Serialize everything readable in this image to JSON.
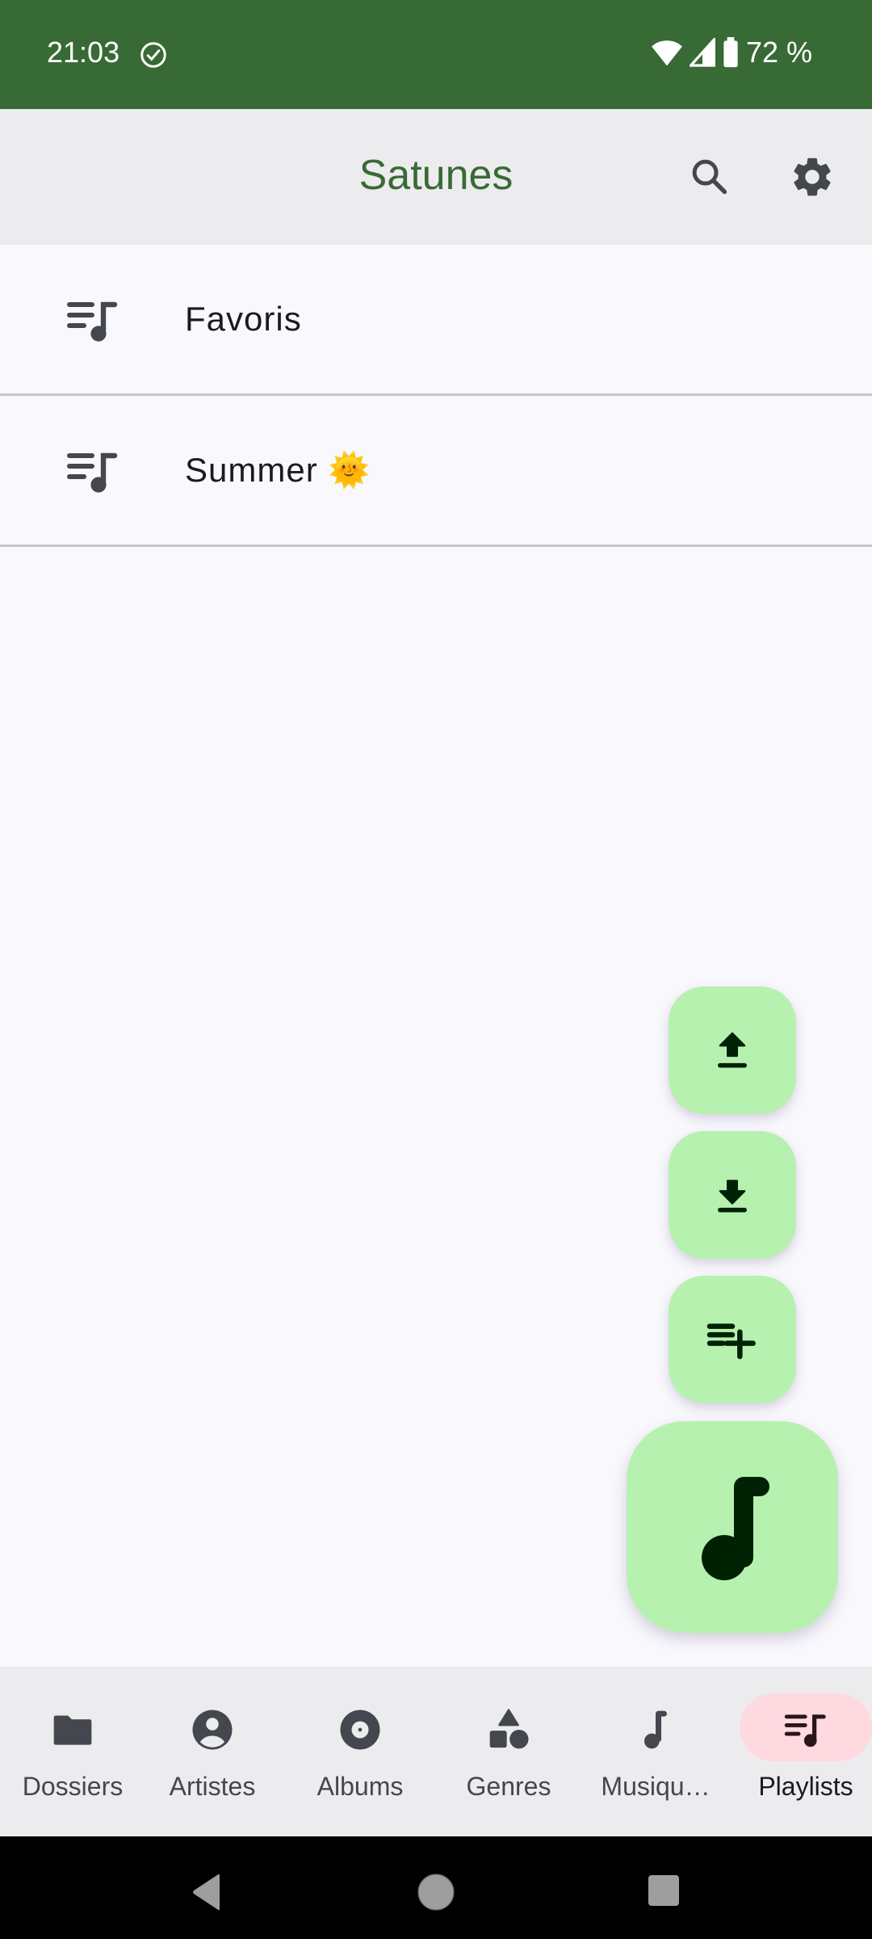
{
  "status_bar": {
    "time": "21:03",
    "battery": "72 %",
    "icons": [
      "check-circle-icon",
      "wifi-icon",
      "signal-icon",
      "battery-icon"
    ]
  },
  "app_bar": {
    "title": "Satunes",
    "actions": [
      "search-icon",
      "settings-icon"
    ]
  },
  "playlists": [
    {
      "label": "Favoris",
      "icon": "playlist-music-icon"
    },
    {
      "label": "Summer 🌞",
      "icon": "playlist-music-icon"
    }
  ],
  "fabs": [
    {
      "name": "export",
      "icon": "upload-icon"
    },
    {
      "name": "import",
      "icon": "download-icon"
    },
    {
      "name": "add-playlist",
      "icon": "playlist-add-icon"
    },
    {
      "name": "player",
      "icon": "music-note-icon"
    }
  ],
  "bottom_nav": {
    "items": [
      {
        "label": "Dossiers",
        "icon": "folder-icon",
        "active": false
      },
      {
        "label": "Artistes",
        "icon": "account-circle-icon",
        "active": false
      },
      {
        "label": "Albums",
        "icon": "album-icon",
        "active": false
      },
      {
        "label": "Genres",
        "icon": "category-icon",
        "active": false
      },
      {
        "label": "Musiqu…",
        "icon": "music-note-icon",
        "active": false
      },
      {
        "label": "Playlists",
        "icon": "playlist-music-icon",
        "active": true
      }
    ]
  },
  "colors": {
    "primary": "#386a35",
    "fab_container": "#b7f1b0",
    "active_indicator": "#ffd9e0",
    "icon": "#44474e"
  }
}
